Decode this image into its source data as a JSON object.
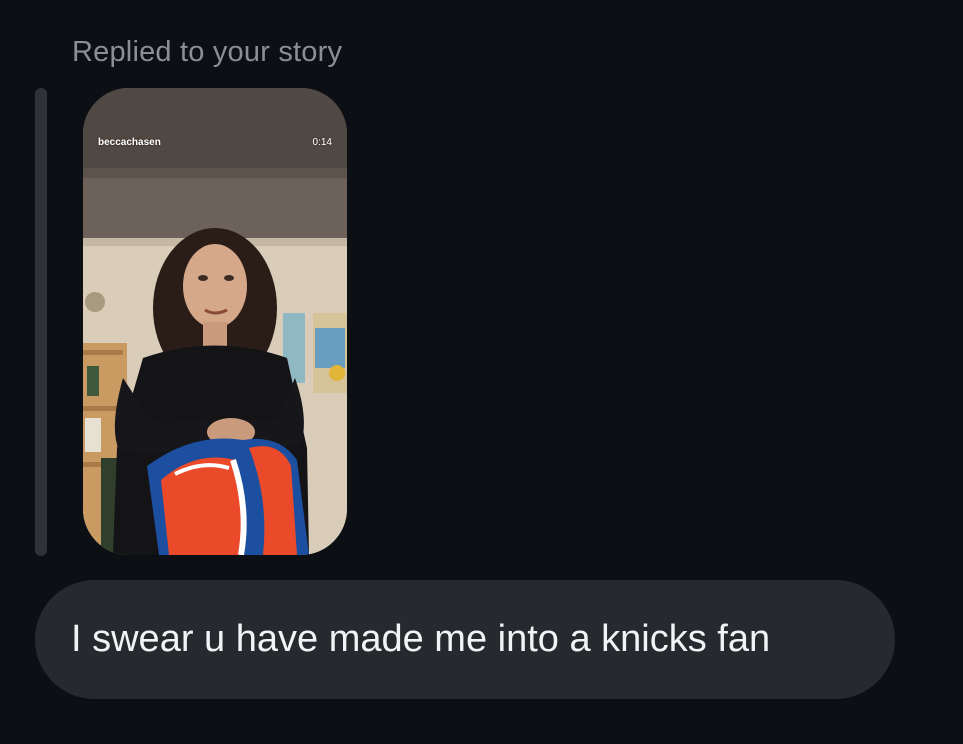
{
  "reply": {
    "label": "Replied to your story"
  },
  "story": {
    "username": "beccachasen",
    "duration": "0:14"
  },
  "message": {
    "text": "I swear u have made me into a knicks fan"
  },
  "colors": {
    "background": "#0c1014",
    "bubble": "#262a2f",
    "label_text": "#8b8f95",
    "message_text": "#f2f3f5",
    "quote_bar": "#2f3338"
  }
}
